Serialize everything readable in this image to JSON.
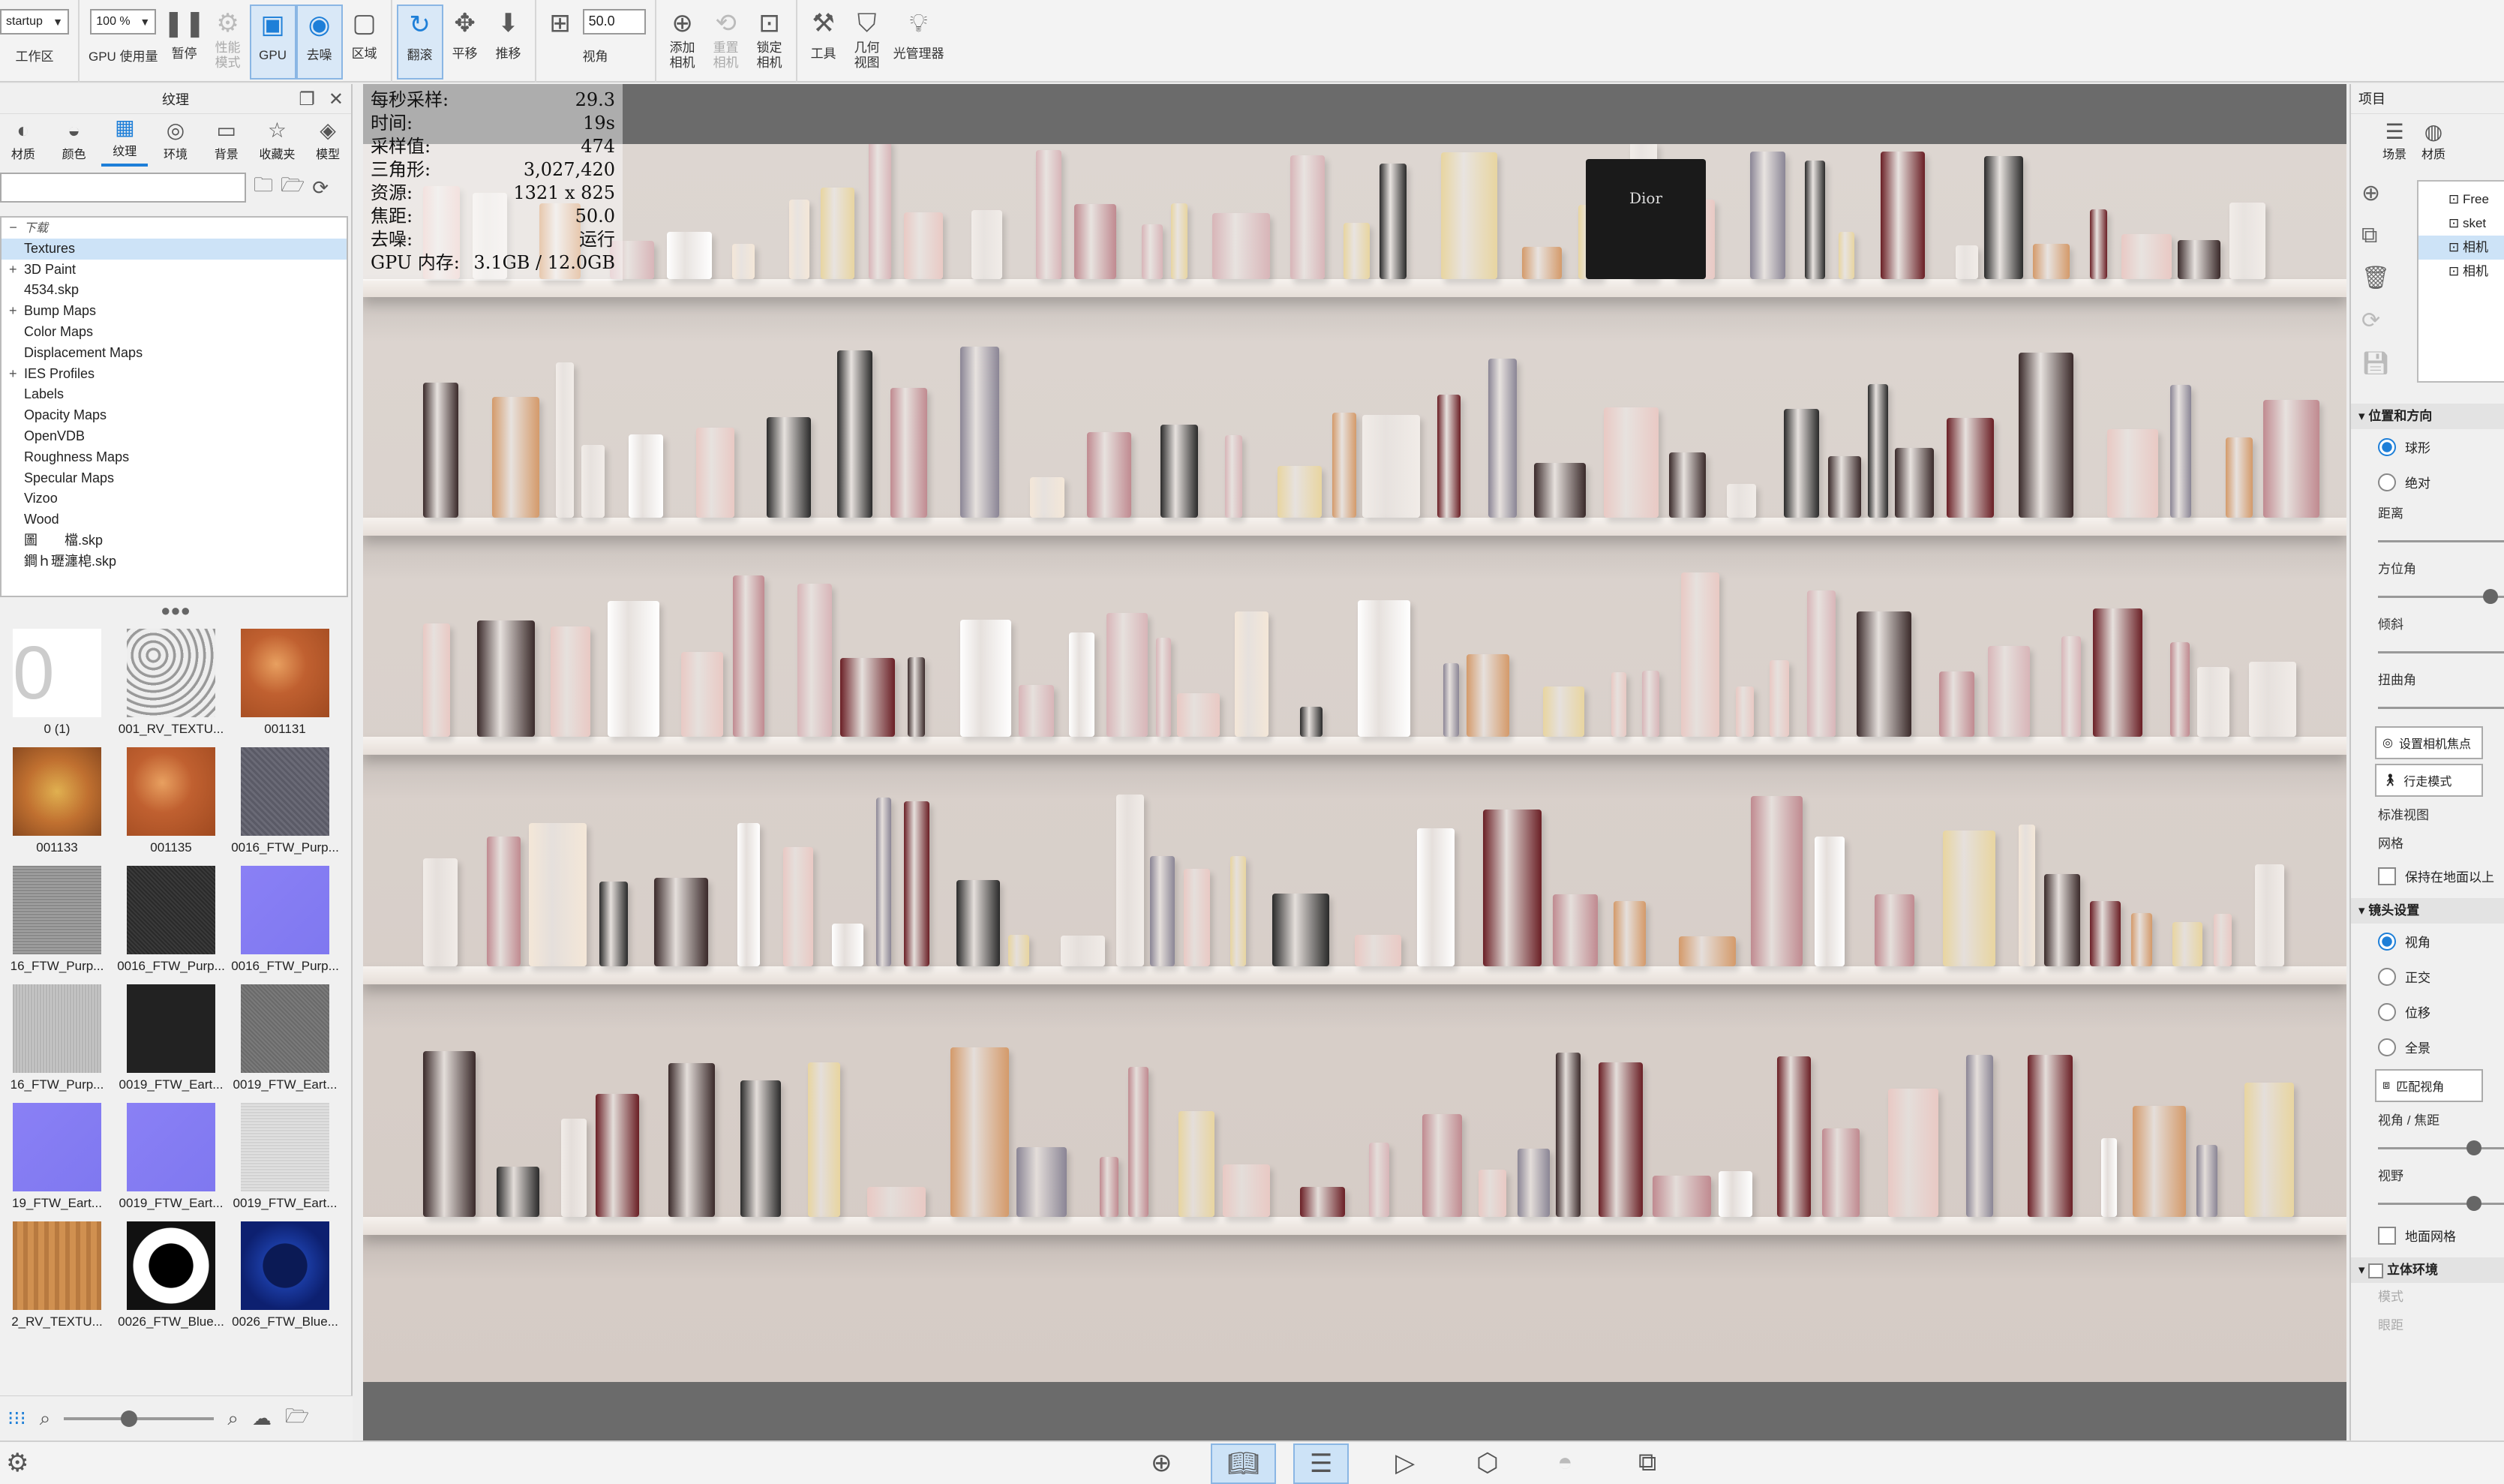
{
  "toolbar": {
    "workspace_value": "startup",
    "workspace_label": "工作区",
    "gpu_usage_value": "100 %",
    "gpu_usage_label": "GPU 使用量",
    "pause_label": "暂停",
    "perf_mode_label": "性能\n模式",
    "gpu_label": "GPU",
    "denoise_label": "去噪",
    "region_label": "区域",
    "orbit_label": "翻滚",
    "pan_label": "平移",
    "dolly_label": "推移",
    "fov_value": "50.0",
    "view_angle_label": "视角",
    "add_camera_label": "添加\n相机",
    "reset_camera_label": "重置\n相机",
    "lock_camera_label": "锁定\n相机",
    "tools_label": "工具",
    "geometry_view_label": "几何\n视图",
    "light_manager_label": "光管理器"
  },
  "left_panel": {
    "title": "纹理",
    "tabs": [
      "材质",
      "颜色",
      "纹理",
      "环境",
      "背景",
      "收藏夹",
      "模型"
    ],
    "search_value": "",
    "tree": [
      {
        "label": "下载",
        "root": true
      },
      {
        "label": "Textures",
        "selected": true
      },
      {
        "label": "3D Paint",
        "expand": "+"
      },
      {
        "label": "4534.skp"
      },
      {
        "label": "Bump Maps",
        "expand": "+"
      },
      {
        "label": "Color Maps"
      },
      {
        "label": "Displacement Maps"
      },
      {
        "label": "IES Profiles",
        "expand": "+"
      },
      {
        "label": "Labels"
      },
      {
        "label": "Opacity Maps"
      },
      {
        "label": "OpenVDB"
      },
      {
        "label": "Roughness Maps"
      },
      {
        "label": "Specular Maps"
      },
      {
        "label": "Vizoo"
      },
      {
        "label": "Wood"
      },
      {
        "label": "圖　　檔.skp"
      },
      {
        "label": "鐧ｈ瓑瀍梍.skp"
      }
    ],
    "thumbnails": [
      {
        "label": "0 (1)",
        "kind": "zero"
      },
      {
        "label": "001_RV_TEXTU...",
        "kind": "noise"
      },
      {
        "label": "001131",
        "kind": "fruit"
      },
      {
        "label": "001133",
        "kind": "fruit2"
      },
      {
        "label": "001135",
        "kind": "fruit"
      },
      {
        "label": "0016_FTW_Purp...",
        "kind": "fabric"
      },
      {
        "label": "16_FTW_Purp...",
        "kind": "grey"
      },
      {
        "label": "0016_FTW_Purp...",
        "kind": "dark"
      },
      {
        "label": "0016_FTW_Purp...",
        "kind": "normal"
      },
      {
        "label": "16_FTW_Purp...",
        "kind": "lightgrey"
      },
      {
        "label": "0019_FTW_Eart...",
        "kind": "black"
      },
      {
        "label": "0019_FTW_Eart...",
        "kind": "midgrey"
      },
      {
        "label": "19_FTW_Eart...",
        "kind": "normal"
      },
      {
        "label": "0019_FTW_Eart...",
        "kind": "normal"
      },
      {
        "label": "0019_FTW_Eart...",
        "kind": "palegrey"
      },
      {
        "label": "2_RV_TEXTU...",
        "kind": "wood"
      },
      {
        "label": "0026_FTW_Blue...",
        "kind": "pattern"
      },
      {
        "label": "0026_FTW_Blue...",
        "kind": "bluepattern"
      }
    ]
  },
  "viewport": {
    "stats": [
      {
        "k": "每秒采样:",
        "v": "29.3"
      },
      {
        "k": "时间:",
        "v": "19s"
      },
      {
        "k": "采样值:",
        "v": "474"
      },
      {
        "k": "三角形:",
        "v": "3,027,420"
      },
      {
        "k": "资源:",
        "v": "1321 x 825"
      },
      {
        "k": "焦距:",
        "v": "50.0"
      },
      {
        "k": "去噪:",
        "v": "运行"
      },
      {
        "k": "GPU 内存:",
        "v": "3.1GB / 12.0GB"
      }
    ],
    "product_label": "Dior"
  },
  "right_panel": {
    "title": "项目",
    "tabs": [
      "场景",
      "材质"
    ],
    "cameras": [
      {
        "label": "Free"
      },
      {
        "label": "sket"
      },
      {
        "label": "相机",
        "selected": true
      },
      {
        "label": "相机"
      }
    ],
    "position_section": "位置和方向",
    "spherical_label": "球形",
    "absolute_label": "绝对",
    "distance_label": "距离",
    "azimuth_label": "方位角",
    "tilt_label": "倾斜",
    "twist_label": "扭曲角",
    "set_focus_label": "设置相机焦点",
    "walk_mode_label": "行走模式",
    "std_view_label": "标准视图",
    "grid_label": "网格",
    "keep_above_label": "保持在地面以上",
    "lens_section": "镜头设置",
    "lens_options": [
      "视角",
      "正交",
      "位移",
      "全景"
    ],
    "match_view_label": "匹配视角",
    "fov_focal_label": "视角 / 焦距",
    "fov_label": "视野",
    "ground_grid_label": "地面网格",
    "stereo_section": "立体环境",
    "mode_label": "模式",
    "eye_dist_label": "眼距"
  },
  "colors": {
    "accent": "#1e7fd8",
    "selection": "#cde3f7"
  }
}
